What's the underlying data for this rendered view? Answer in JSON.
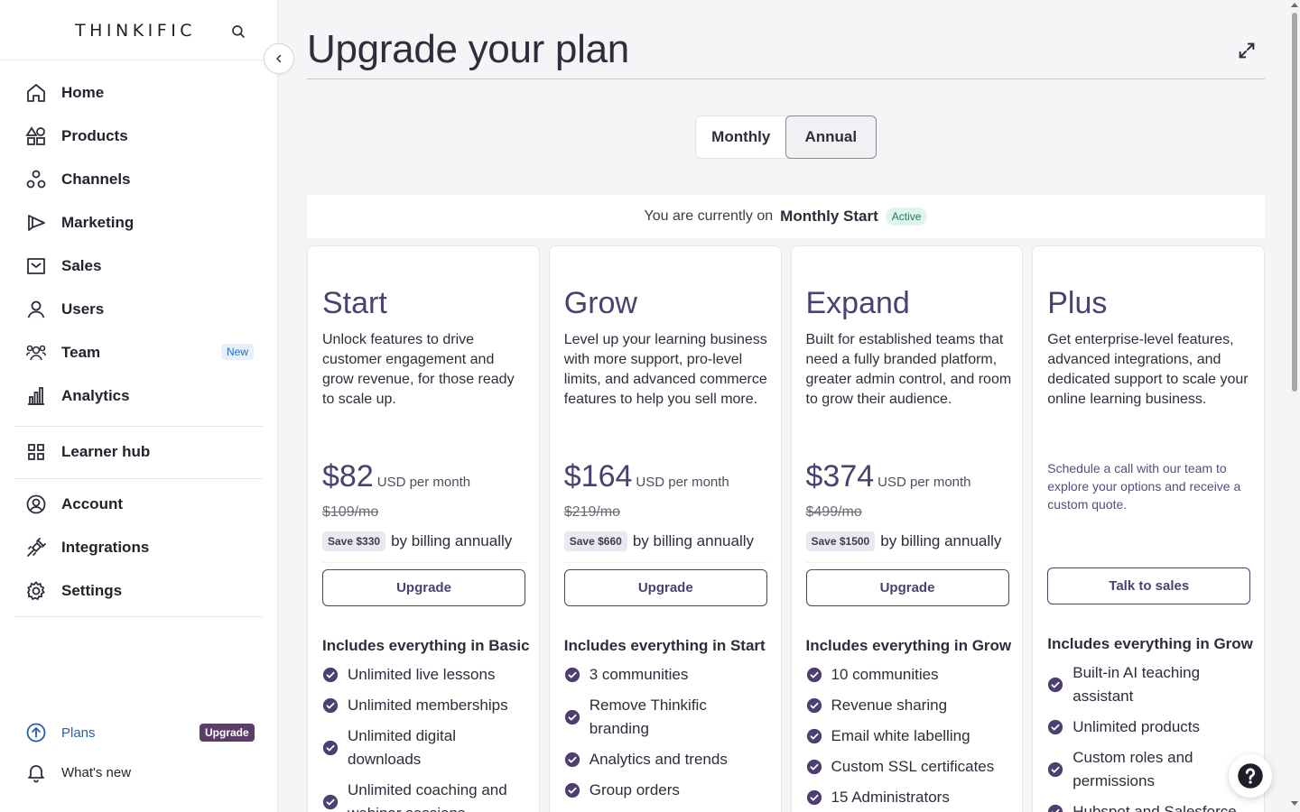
{
  "sidebar": {
    "logo": "THINKIFIC",
    "nav": [
      {
        "label": "Home"
      },
      {
        "label": "Products"
      },
      {
        "label": "Channels"
      },
      {
        "label": "Marketing"
      },
      {
        "label": "Sales"
      },
      {
        "label": "Users"
      },
      {
        "label": "Team",
        "badge": "New"
      },
      {
        "label": "Analytics"
      },
      {
        "label": "Learner hub"
      },
      {
        "label": "Account"
      },
      {
        "label": "Integrations"
      },
      {
        "label": "Settings"
      }
    ],
    "bottom": {
      "plans_label": "Plans",
      "plans_badge": "Upgrade",
      "whats_new_label": "What's new"
    }
  },
  "main": {
    "title": "Upgrade your plan",
    "billing_toggle": {
      "monthly": "Monthly",
      "annual": "Annual",
      "selected": "Annual"
    },
    "current": {
      "prefix": "You are currently on",
      "plan": "Monthly Start",
      "status": "Active"
    },
    "plans": [
      {
        "name": "Start",
        "description": "Unlock features to drive customer engagement and grow revenue, for those ready to scale up.",
        "price": "$82",
        "price_unit": "USD per month",
        "old_price": "$109/mo",
        "save": "Save $330",
        "save_text": "by billing annually",
        "cta": "Upgrade",
        "includes": "Includes everything in Basic",
        "features": [
          "Unlimited live lessons",
          "Unlimited memberships",
          "Unlimited digital downloads",
          "Unlimited coaching and webinar sessions"
        ]
      },
      {
        "name": "Grow",
        "description": "Level up your learning business with more support, pro-level limits, and advanced commerce features to help you sell more.",
        "price": "$164",
        "price_unit": "USD per month",
        "old_price": "$219/mo",
        "save": "Save $660",
        "save_text": "by billing annually",
        "cta": "Upgrade",
        "includes": "Includes everything in Start",
        "features": [
          "3 communities",
          "Remove Thinkific branding",
          "Analytics and trends",
          "Group orders"
        ]
      },
      {
        "name": "Expand",
        "description": "Built for established teams that need a fully branded platform, greater admin control, and room to grow their audience.",
        "price": "$374",
        "price_unit": "USD per month",
        "old_price": "$499/mo",
        "save": "Save $1500",
        "save_text": "by billing annually",
        "cta": "Upgrade",
        "includes": "Includes everything in Grow",
        "features": [
          "10 communities",
          "Revenue sharing",
          "Email white labelling",
          "Custom SSL certificates",
          "15 Administrators"
        ]
      },
      {
        "name": "Plus",
        "description": "Get enterprise-level features, advanced integrations, and dedicated support to scale your online learning business.",
        "sales_note": "Schedule a call with our team to explore your options and receive a custom quote.",
        "cta": "Talk to sales",
        "includes": "Includes everything in Grow",
        "features": [
          "Built-in AI teaching assistant",
          "Unlimited products",
          "Custom roles and permissions",
          "Hubspot and Salesforce"
        ]
      }
    ]
  },
  "colors": {
    "accent": "#4e3f72",
    "link": "#2a5db0",
    "active_badge_bg": "#dff4ec",
    "upgrade_badge_bg": "#5b3d6a"
  }
}
